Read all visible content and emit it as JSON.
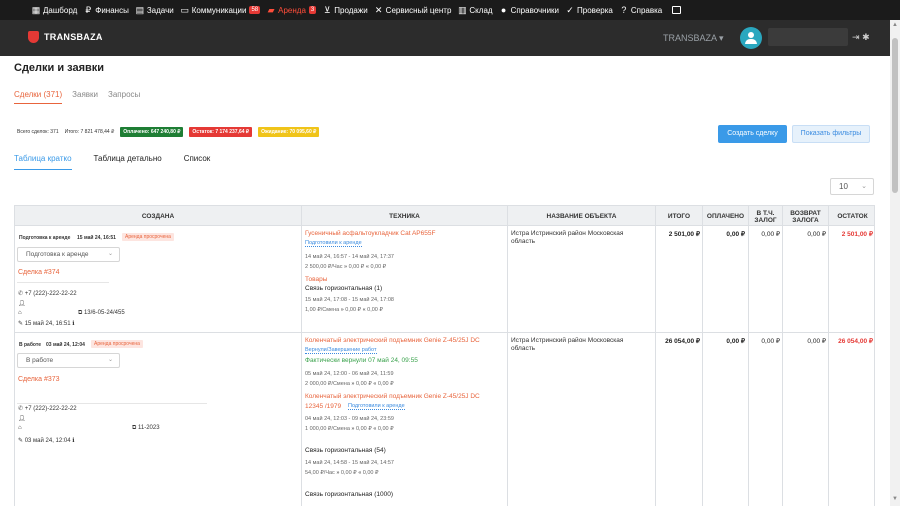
{
  "topnav": {
    "items": [
      {
        "label": "Дашборд",
        "icon": "grid-icon"
      },
      {
        "label": "Финансы",
        "icon": "ruble-icon"
      },
      {
        "label": "Задачи",
        "icon": "document-icon"
      },
      {
        "label": "Коммуникации",
        "icon": "chat-icon",
        "badge": "58"
      },
      {
        "label": "Аренда",
        "icon": "truck-icon",
        "badge": "3"
      },
      {
        "label": "Продажи",
        "icon": "cart-icon"
      },
      {
        "label": "Сервисный центр",
        "icon": "wrench-icon"
      },
      {
        "label": "Склад",
        "icon": "warehouse-icon"
      },
      {
        "label": "Справочники",
        "icon": "users-icon"
      },
      {
        "label": "Проверка",
        "icon": "check-icon"
      },
      {
        "label": "Справка",
        "icon": "help-icon"
      }
    ]
  },
  "header": {
    "logo": "TRANSBAZA",
    "company": "TRANSBAZA ▾"
  },
  "page": {
    "title": "Сделки и заявки",
    "tabs": [
      "Сделки (371)",
      "Заявки",
      "Запросы"
    ]
  },
  "stats": {
    "total_deals": "Всего сделок: 371",
    "total_sum": "Итого: 7 821 478,44 ₽",
    "paid": "Оплачено: 647 240,80 ₽",
    "remaining": "Остаток: 7 174 237,64 ₽",
    "pending": "Ожидание: 70 095,60 ₽",
    "colors": {
      "paid": "#1e7e34",
      "remaining": "#e53935",
      "pending": "#f0c419"
    }
  },
  "buttons": {
    "create": "Создать сделку",
    "filters": "Показать фильтры"
  },
  "view_tabs": [
    "Таблица кратко",
    "Таблица детально",
    "Список"
  ],
  "page_size": "10",
  "table": {
    "headers": [
      "СОЗДАНА",
      "ТЕХНИКА",
      "НАЗВАНИЕ ОБЪЕКТА",
      "ИТОГО",
      "ОПЛАЧЕНО",
      "В Т.Ч. ЗАЛОГ",
      "ВОЗВРАТ ЗАЛОГА",
      "ОСТАТОК"
    ],
    "rows": [
      {
        "status": "Подготовка к аренде",
        "date": "15 май 24, 16:51",
        "overdue": "Аренда просрочена",
        "select_value": "Подготовка к аренде",
        "deal": "Сделка #374",
        "phone": "+7 (222)-222-22-22",
        "doc": "13/6-05-24/455",
        "created_at": "15 май 24, 16:51",
        "tech1_name": "Гусеничный асфальтоукладчик Cat AP655F",
        "tech1_status": "Подготовили к аренде",
        "tech1_period": "14 май 24, 16:57 - 14 май 24, 17:37",
        "tech1_price": "2 500,00 ₽/Час",
        "tech1_a": "0,00 ₽",
        "tech1_b": "0,00 ₽",
        "goods_label": "Товары",
        "goods_name": "Связь горизонтальная (1)",
        "goods_period": "15 май 24, 17:08 - 15 май 24, 17:08",
        "goods_price": "1,00 ₽/Смена",
        "goods_a": "0,00 ₽",
        "goods_b": "0,00 ₽",
        "object": "Истра Истринский район Московская область",
        "total": "2 501,00 ₽",
        "paid": "0,00 ₽",
        "deposit": "0,00 ₽",
        "deposit_return": "0,00 ₽",
        "remaining": "2 501,00 ₽"
      },
      {
        "status": "В работе",
        "date": "03 май 24, 12:04",
        "overdue": "Аренда просрочена",
        "select_value": "В работе",
        "deal": "Сделка #373",
        "phone": "+7 (222)-222-22-22",
        "doc": "11-2023",
        "created_at": "03 май 24, 12:04",
        "tech1_name": "Коленчатый электрический подъемник Genie Z-45/25J DC",
        "tech1_status": "Вернули/Завершение работ",
        "tech1_returned": "Фактически вернули 07 май 24, 09:55",
        "tech1_period": "05 май 24, 12:00 - 06 май 24, 11:59",
        "tech1_price": "2 000,00 ₽/Смена",
        "tech1_a": "0,00 ₽",
        "tech1_b": "0,00 ₽",
        "tech2_name": "Коленчатый электрический подъемник Genie Z-45/25J DC",
        "tech2_name2": "12345 /1979",
        "tech2_status": "Подготовили к аренде",
        "tech2_period": "04 май 24, 12:03 - 09 май 24, 23:59",
        "tech2_price": "1 000,00 ₽/Смена",
        "tech2_a": "0,00 ₽",
        "tech2_b": "0,00 ₽",
        "goods_name": "Связь горизонтальная (54)",
        "goods_period": "14 май 24, 14:58 - 15 май 24, 14:57",
        "goods_price": "54,00 ₽/Час",
        "goods_a": "0,00 ₽",
        "goods_b": "0,00 ₽",
        "goods2_name": "Связь горизонтальная (1000)",
        "object": "Истра Истринский район Московская область",
        "total": "26 054,00 ₽",
        "paid": "0,00 ₽",
        "deposit": "0,00 ₽",
        "deposit_return": "0,00 ₽",
        "remaining": "26 054,00 ₽"
      }
    ]
  }
}
